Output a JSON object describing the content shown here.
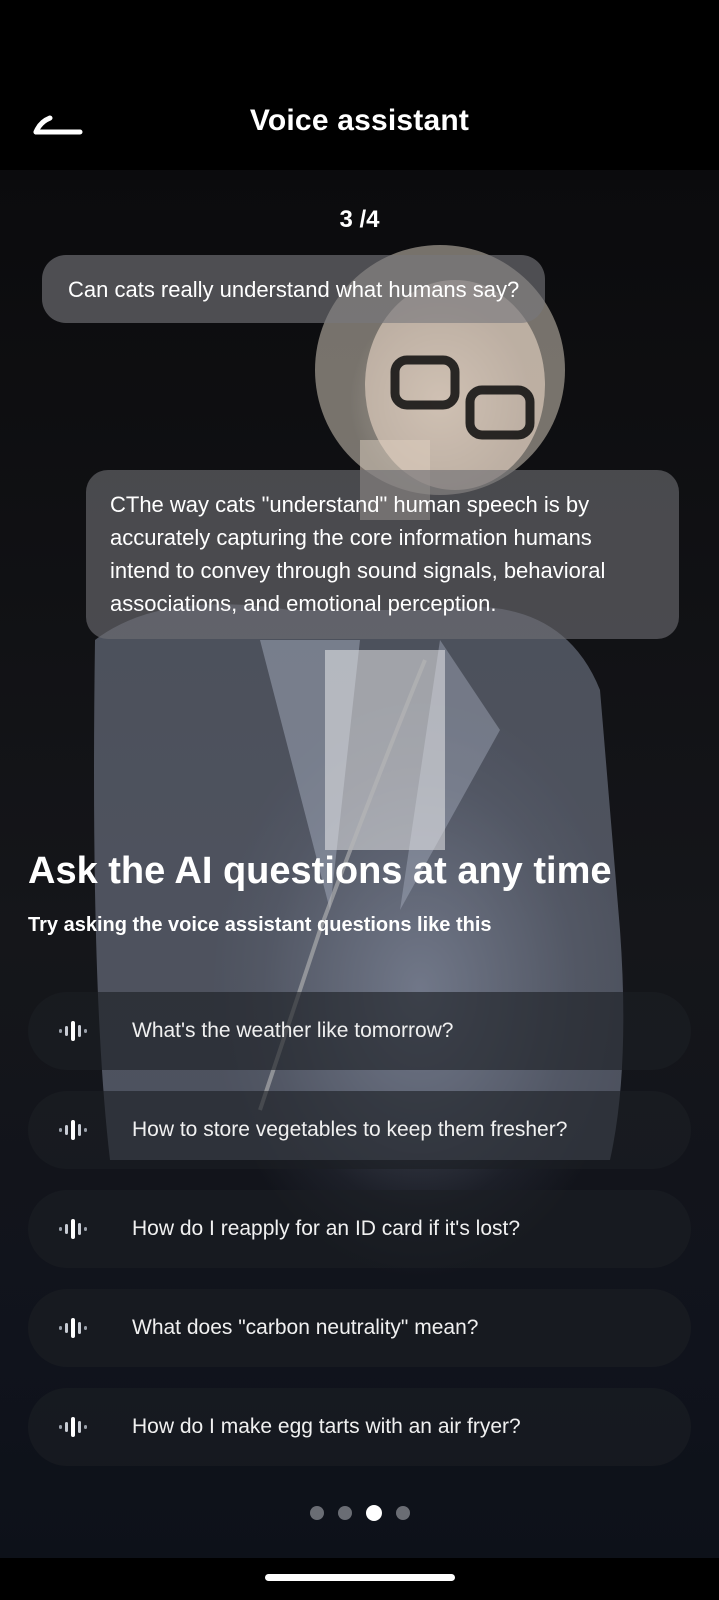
{
  "header": {
    "title": "Voice assistant",
    "back_icon": "back-arrow-icon"
  },
  "counter": "3 /4",
  "chat": {
    "question": "Can cats really understand what humans say?",
    "answer": "CThe way cats \"understand\" human speech is by accurately capturing the core information humans intend to convey through sound signals, behavioral associations, and emotional perception."
  },
  "intro": {
    "headline": "Ask the AI questions at any time",
    "subline": "Try asking the voice assistant questions like this"
  },
  "suggestions": [
    {
      "text": "What's the weather like tomorrow?",
      "icon": "voice-wave-icon"
    },
    {
      "text": "How to store vegetables to keep them fresher?",
      "icon": "voice-wave-icon"
    },
    {
      "text": "How do I reapply for an ID card if it's lost?",
      "icon": "voice-wave-icon"
    },
    {
      "text": "What does \"carbon neutrality\" mean?",
      "icon": "voice-wave-icon"
    },
    {
      "text": "How do I make egg tarts with an air fryer?",
      "icon": "voice-wave-icon"
    }
  ],
  "pagination": {
    "total": 4,
    "current": 3
  },
  "colors": {
    "background": "#000000",
    "bubble": "#78787d",
    "dot_inactive": "#6a6d74",
    "dot_active": "#ffffff"
  }
}
